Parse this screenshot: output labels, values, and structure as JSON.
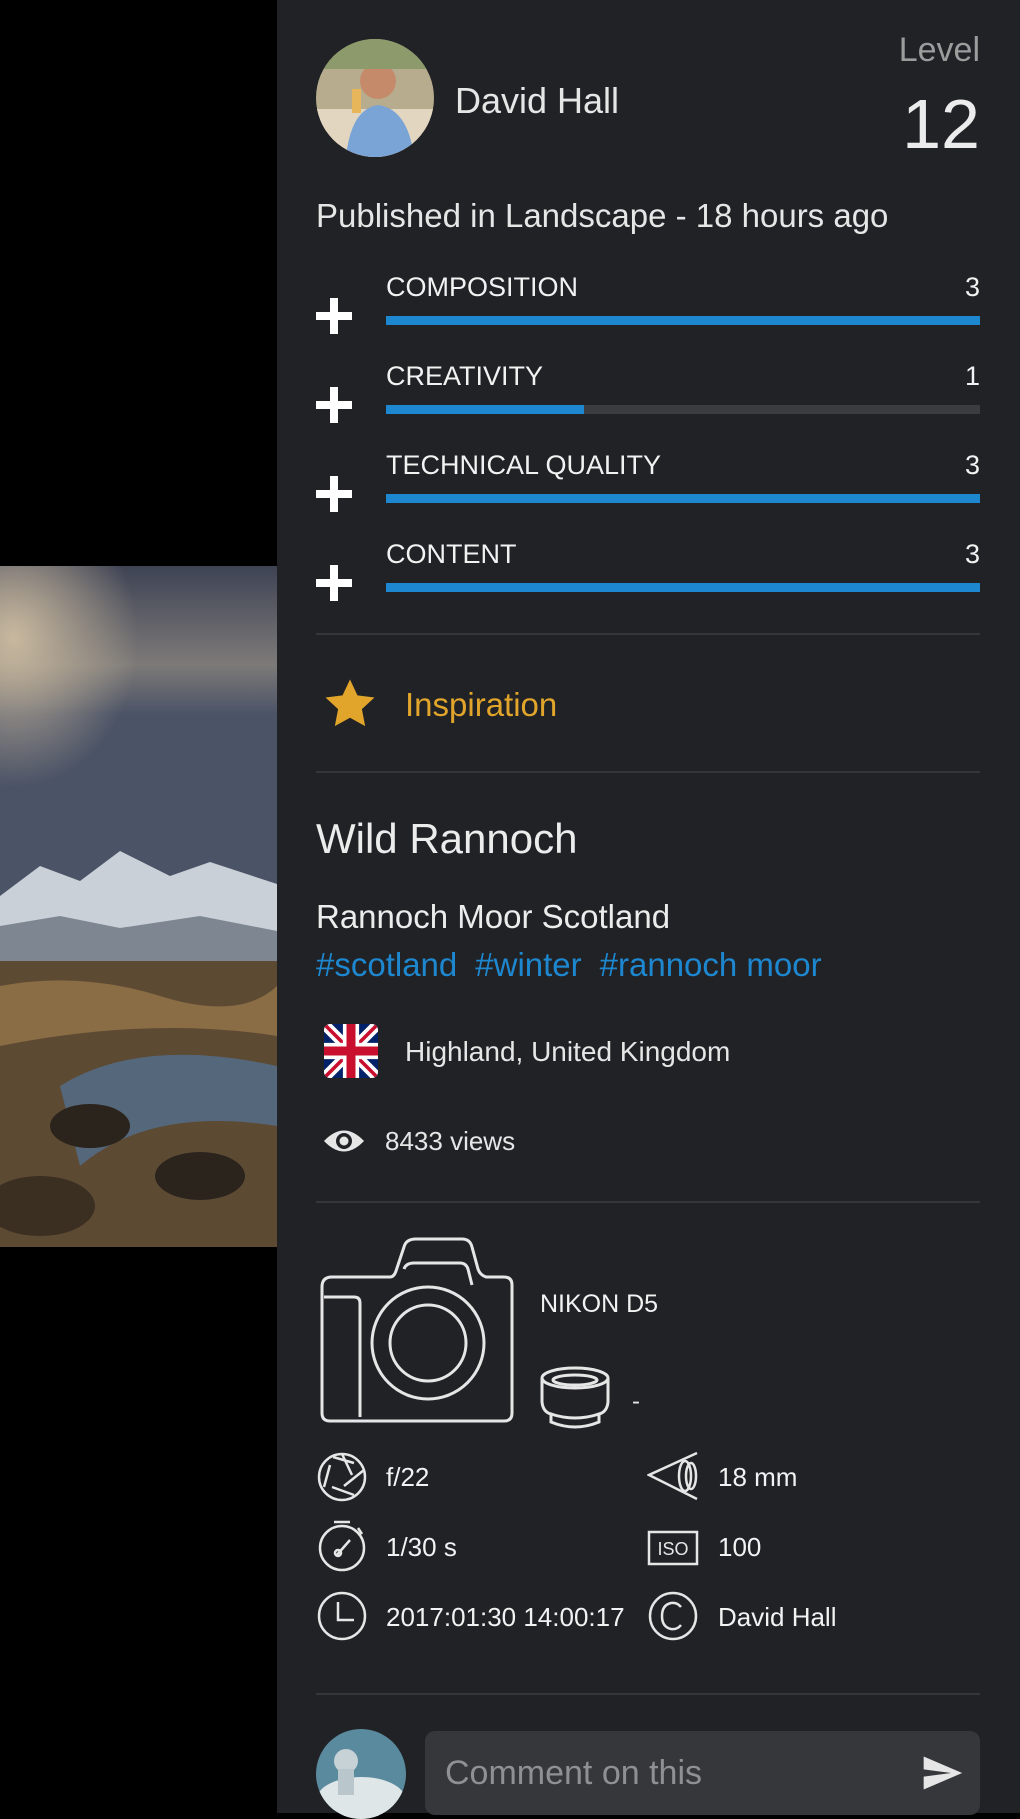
{
  "user": {
    "name": "David Hall",
    "level_label": "Level",
    "level_value": "12"
  },
  "published": "Published in Landscape - 18 hours ago",
  "ratings": [
    {
      "label": "COMPOSITION",
      "value": "3",
      "fill": 1.0
    },
    {
      "label": "CREATIVITY",
      "value": "1",
      "fill": 0.333
    },
    {
      "label": "TECHNICAL QUALITY",
      "value": "3",
      "fill": 1.0
    },
    {
      "label": "CONTENT",
      "value": "3",
      "fill": 1.0
    }
  ],
  "award": {
    "label": "Inspiration",
    "icon": "star-icon",
    "color": "#e0a52a"
  },
  "photo": {
    "title": "Wild Rannoch",
    "subtitle": "Rannoch Moor Scotland",
    "tags": [
      "#scotland",
      "#winter",
      "#rannoch moor"
    ],
    "location": "Highland, United Kingdom",
    "location_flag": "uk-flag-icon",
    "views": "8433 views"
  },
  "exif": {
    "camera": "NIKON D5",
    "lens": "-",
    "aperture": "f/22",
    "focal_length": "18 mm",
    "shutter": "1/30 s",
    "iso": "100",
    "datetime": "2017:01:30 14:00:17",
    "copyright": "David Hall"
  },
  "comment": {
    "placeholder": "Comment on this"
  },
  "colors": {
    "accent": "#1d87cf",
    "award": "#e0a52a",
    "panel": "#212226"
  }
}
